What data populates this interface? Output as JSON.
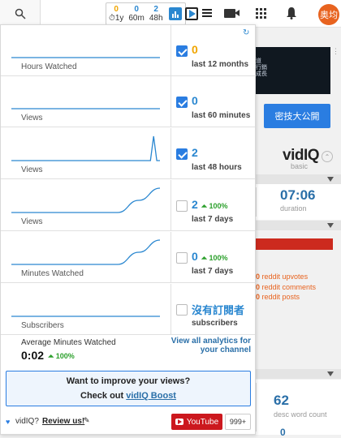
{
  "topbar": {
    "stats": [
      {
        "top": "0",
        "bottom": "1y",
        "top_color": "#f0a500"
      },
      {
        "top": "0",
        "bottom": "60m",
        "top_color": "#2a87d0"
      },
      {
        "top": "2",
        "bottom": "48h",
        "top_color": "#2a87d0"
      }
    ],
    "avatar_text": "奥均"
  },
  "rows": [
    {
      "label": "Hours Watched",
      "value": "0",
      "value_color": "orange",
      "delta": "",
      "period": "last 12 months",
      "checked": true,
      "line": [
        0,
        0,
        0,
        0,
        0,
        0,
        0,
        0,
        0,
        0,
        0,
        0
      ]
    },
    {
      "label": "Views",
      "value": "0",
      "value_color": "blue",
      "delta": "",
      "period": "last 60 minutes",
      "checked": true,
      "line": [
        0,
        0,
        0,
        0,
        0,
        0,
        0,
        0,
        0,
        0,
        0,
        0
      ]
    },
    {
      "label": "Views",
      "value": "2",
      "value_color": "blue",
      "delta": "",
      "period": "last 48 hours",
      "checked": true,
      "line": [
        0,
        0,
        0,
        0,
        0,
        0,
        0,
        0,
        0,
        0,
        0,
        0,
        0,
        0,
        0,
        0,
        0,
        0,
        0,
        0,
        0,
        0,
        0,
        0,
        0,
        0,
        0,
        0,
        0,
        0,
        0,
        0,
        0,
        0,
        0,
        0,
        0,
        0,
        0,
        0,
        0,
        0,
        0,
        0,
        0,
        2,
        0,
        0
      ]
    },
    {
      "label": "Views",
      "value": "2",
      "value_color": "blue",
      "delta": "100%",
      "period": "last 7 days",
      "checked": false,
      "line": [
        0,
        0,
        0,
        0,
        0,
        0,
        1,
        2
      ]
    },
    {
      "label": "Minutes Watched",
      "value": "0",
      "value_color": "blue",
      "delta": "100%",
      "period": "last 7 days",
      "checked": false,
      "line": [
        0,
        0,
        0,
        0,
        0,
        0,
        1,
        2
      ]
    },
    {
      "label": "Subscribers",
      "value": "沒有訂閱者",
      "value_color": "blue",
      "delta": "",
      "period": "subscribers",
      "checked": false,
      "line": [
        0,
        0,
        0,
        0,
        0,
        0,
        0,
        0
      ]
    }
  ],
  "footer": {
    "avg_label": "Average Minutes Watched",
    "avg_value": "0:02",
    "avg_delta": "100%",
    "all_analytics_link": "View all analytics for your channel"
  },
  "promo": {
    "line1": "Want to improve your views?",
    "line2_prefix": "Check out ",
    "line2_link": "vidIQ Boost"
  },
  "bottom": {
    "love_text": "vidIQ?",
    "review_link": "Review us!",
    "youtube_label": "YouTube",
    "count_badge": "999+"
  },
  "background": {
    "ad_button": "密技大公開",
    "ad_fragments": [
      "道",
      "行銷",
      "成長"
    ],
    "vidiq_logo": "vidIQ",
    "vidiq_sub": "basic",
    "duration_value": "07:06",
    "duration_label": "duration",
    "reddit": [
      {
        "count": "0",
        "label": "reddit upvotes"
      },
      {
        "count": "0",
        "label": "reddit comments"
      },
      {
        "count": "0",
        "label": "reddit posts"
      }
    ],
    "desc_value": "62",
    "desc_label": "desc word count",
    "partial_value": "0"
  },
  "colors": {
    "accent": "#2a87d0",
    "orange": "#f0a500",
    "green": "#2ca02c",
    "youtube": "#cc181e"
  }
}
